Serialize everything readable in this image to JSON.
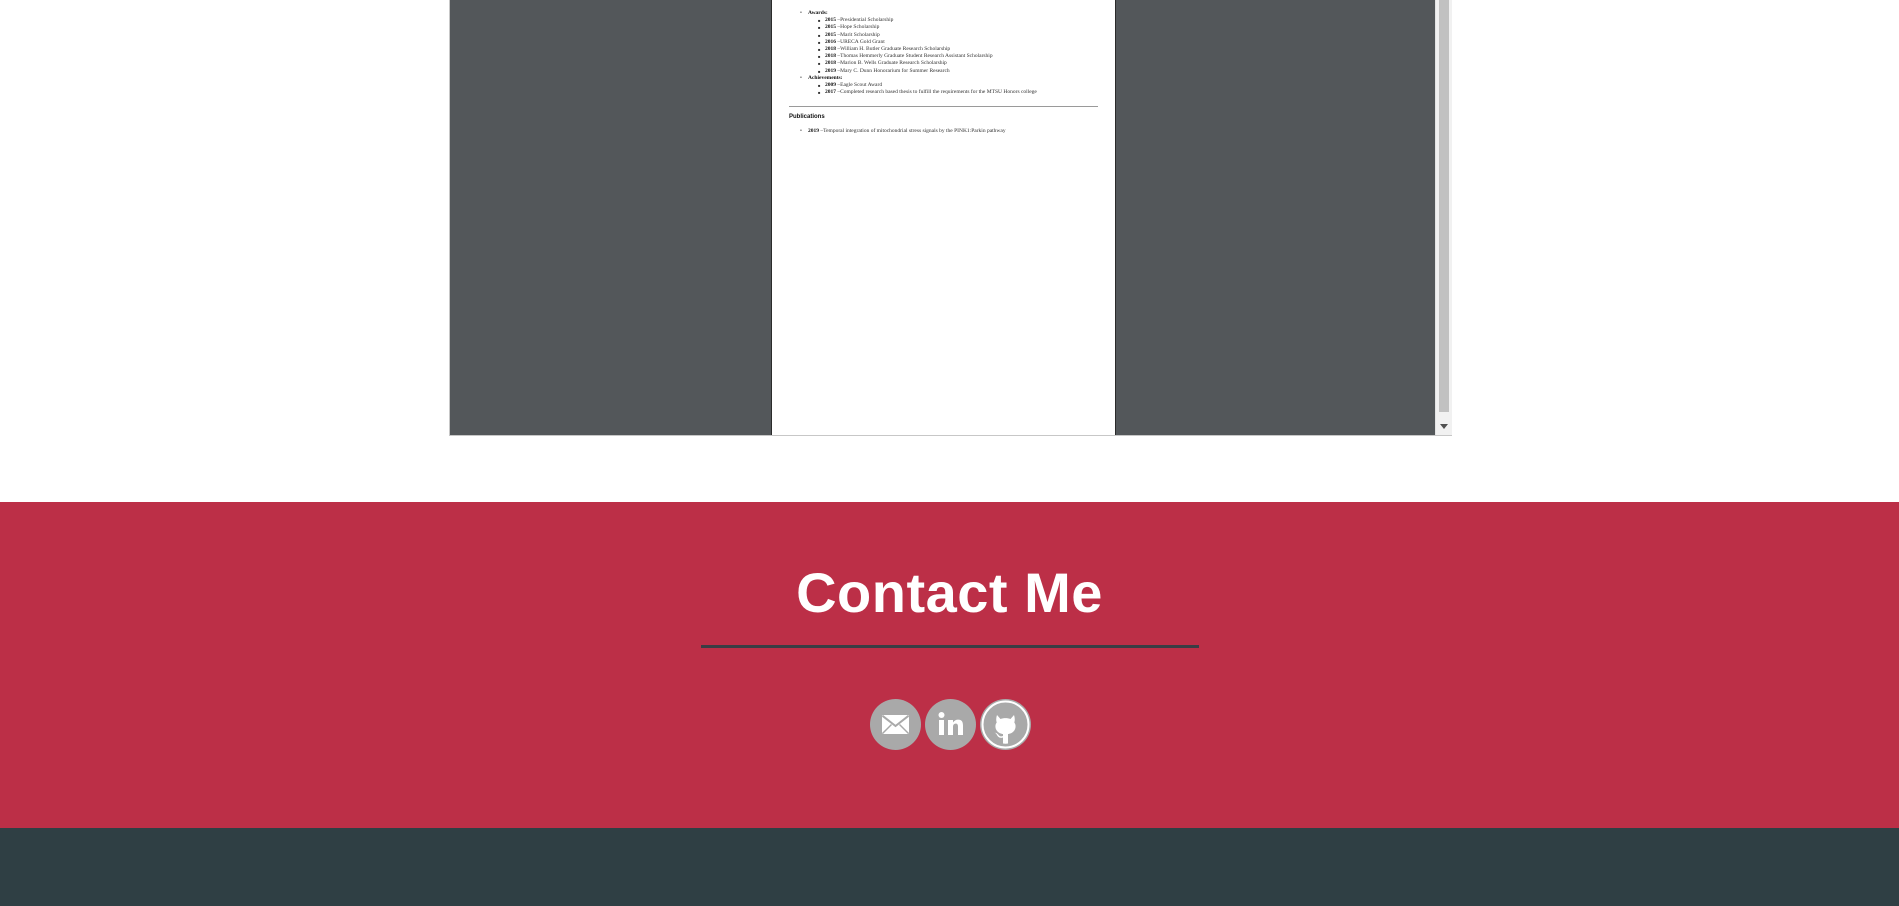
{
  "pdf": {
    "awards_label": "Awards:",
    "awards": [
      {
        "year": "2015",
        "text": " –Presidential Scholarship"
      },
      {
        "year": "2015",
        "text": " –Hope Scholarship"
      },
      {
        "year": "2015",
        "text": " –Marit Scholarship"
      },
      {
        "year": "2016",
        "text": " –URECA Gold Grant"
      },
      {
        "year": "2018",
        "text": " –William H. Butler Graduate Research Scholarship"
      },
      {
        "year": "2018",
        "text": " –Thomas Hemmerly Graduate Student Research Assistant Scholarship"
      },
      {
        "year": "2018",
        "text": " –Marion B. Wells Graduate Research Scholarship"
      },
      {
        "year": "2019",
        "text": " –Mary C. Dunn Honorarium for Summer Research"
      }
    ],
    "achievements_label": "Achievements:",
    "achievements": [
      {
        "year": "2009",
        "text": " –Eagle Scout Award"
      },
      {
        "year": "2017",
        "text": " –Completed research based thesis to fulfill the requirements for the MTSU Honors college"
      }
    ],
    "publications_heading": "Publications",
    "publications": [
      {
        "year": "2019",
        "text": " –Temporal integration of mitochondrial stress signals by the PINK1:Parkin pathway"
      }
    ]
  },
  "contact": {
    "title": "Contact Me",
    "icons": [
      "email-icon",
      "linkedin-icon",
      "github-icon"
    ]
  },
  "colors": {
    "contact_bg": "#bc2f47",
    "footer_bg": "#2f3f44",
    "viewer_bg": "#53575a",
    "icon_gray": "#a9a9a9"
  }
}
